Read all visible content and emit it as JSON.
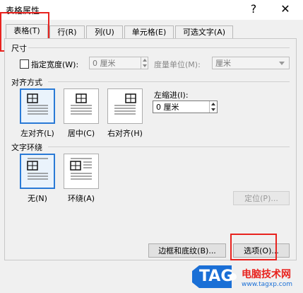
{
  "window": {
    "title": "表格属性",
    "help": "?",
    "close": "✕"
  },
  "tabs": [
    {
      "label": "表格(T)"
    },
    {
      "label": "行(R)"
    },
    {
      "label": "列(U)"
    },
    {
      "label": "单元格(E)"
    },
    {
      "label": "可选文字(A)"
    }
  ],
  "size": {
    "section_label": "尺寸",
    "specify_width_label": "指定宽度(W):",
    "width_value": "0 厘米",
    "unit_label": "度量单位(M):",
    "unit_value": "厘米"
  },
  "alignment": {
    "section_label": "对齐方式",
    "options": [
      {
        "label": "左对齐(L)"
      },
      {
        "label": "居中(C)"
      },
      {
        "label": "右对齐(H)"
      }
    ],
    "indent_label": "左缩进(I):",
    "indent_value": "0 厘米"
  },
  "wrapping": {
    "section_label": "文字环绕",
    "options": [
      {
        "label": "无(N)"
      },
      {
        "label": "环绕(A)"
      }
    ],
    "position_button": "定位(P)..."
  },
  "buttons": {
    "borders": "边框和底纹(B)...",
    "options": "选项(O)..."
  },
  "watermark": {
    "brand": "TAG",
    "text": "电脑技术网",
    "url": "www.tagxp.com"
  },
  "colors": {
    "highlight": "#e8231f",
    "selected_border": "#2a7ad6"
  }
}
